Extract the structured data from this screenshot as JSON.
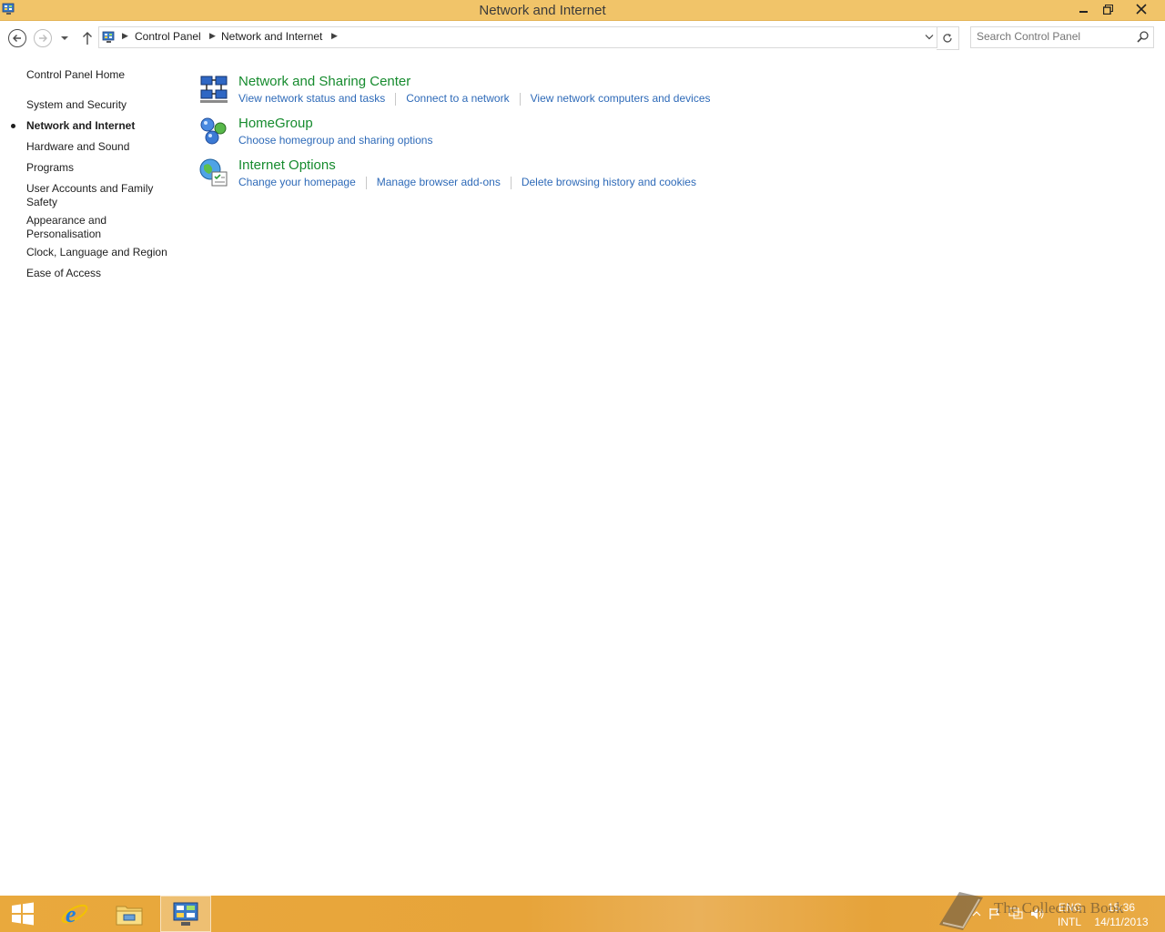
{
  "window": {
    "title": "Network and Internet",
    "icon": "control-panel-icon"
  },
  "address_bar": {
    "breadcrumbs": [
      "Control Panel",
      "Network and Internet"
    ],
    "search_placeholder": "Search Control Panel"
  },
  "left_nav": {
    "home": "Control Panel Home",
    "items": [
      {
        "label": "System and Security",
        "current": false
      },
      {
        "label": "Network and Internet",
        "current": true
      },
      {
        "label": "Hardware and Sound",
        "current": false
      },
      {
        "label": "Programs",
        "current": false
      },
      {
        "label": "User Accounts and Family Safety",
        "current": false
      },
      {
        "label": "Appearance and Personalisation",
        "current": false
      },
      {
        "label": "Clock, Language and Region",
        "current": false
      },
      {
        "label": "Ease of Access",
        "current": false
      }
    ]
  },
  "categories": [
    {
      "title": "Network and Sharing Center",
      "icon": "network-sharing-icon",
      "links": [
        "View network status and tasks",
        "Connect to a network",
        "View network computers and devices"
      ]
    },
    {
      "title": "HomeGroup",
      "icon": "homegroup-icon",
      "links": [
        "Choose homegroup and sharing options"
      ]
    },
    {
      "title": "Internet Options",
      "icon": "internet-options-icon",
      "links": [
        "Change your homepage",
        "Manage browser add-ons",
        "Delete browsing history and cookies"
      ]
    }
  ],
  "taskbar": {
    "apps": [
      "start-icon",
      "internet-explorer-icon",
      "file-explorer-icon",
      "control-panel-icon"
    ],
    "language": "ENG",
    "layout": "INTL",
    "time": "15:36",
    "date": "14/11/2013",
    "watermark": "The Collection Book"
  },
  "colors": {
    "titlebar": "#f1c469",
    "taskbar": "#e9a93d",
    "category_title": "#168b2e",
    "link": "#2e6ab8"
  }
}
